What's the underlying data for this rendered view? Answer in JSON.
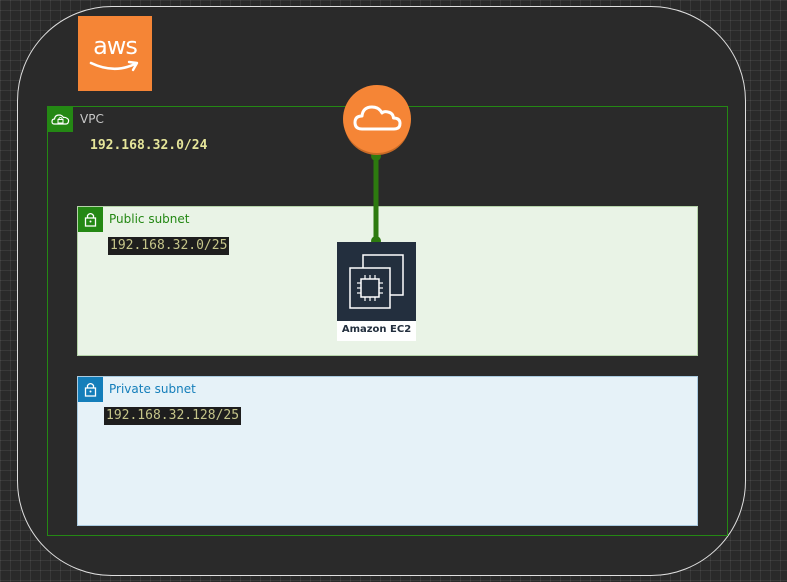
{
  "diagram": {
    "provider_logo": {
      "text": "aws",
      "icon": "aws-logo-icon",
      "color": "#f58536"
    },
    "vpc": {
      "label": "VPC",
      "cidr": "192.168.32.0/24",
      "icon": "vpc-cloud-lock-icon",
      "color": "#248814"
    },
    "public_subnet": {
      "label": "Public subnet",
      "cidr": "192.168.32.0/25",
      "icon": "lock-icon",
      "color": "#248814",
      "fill": "#e9f3e6"
    },
    "private_subnet": {
      "label": "Private subnet",
      "cidr": "192.168.32.128/25",
      "icon": "lock-icon",
      "color": "#147eba",
      "fill": "#e6f2f8"
    },
    "internet_gateway": {
      "icon": "internet-cloud-icon",
      "color": "#f58536"
    },
    "ec2": {
      "label": "Amazon EC2",
      "icon": "ec2-chip-icon",
      "color": "#232f3e"
    },
    "connection": {
      "from": "internet_gateway",
      "to": "ec2",
      "color": "#2d7a0f"
    }
  }
}
